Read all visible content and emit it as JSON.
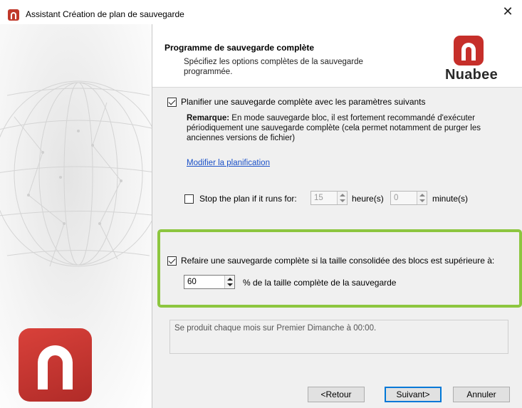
{
  "window": {
    "title": "Assistant Création de plan de sauvegarde",
    "close_symbol": "✕"
  },
  "brand": {
    "name": "Nuabee",
    "accent": "#c62f2a"
  },
  "header": {
    "title": "Programme de sauvegarde complète",
    "description": "Spécifiez les options complètes de la sauvegarde programmée."
  },
  "schedule": {
    "checkbox_label": "Planifier une sauvegarde complète avec les paramètres suivants",
    "checked": true,
    "note_label": "Remarque:",
    "note_text": " En mode sauvegarde bloc, il est fortement recommandé d'exécuter périodiquement une sauvegarde complète (cela permet notamment de purger les anciennes versions de fichier)",
    "modify_link": "Modifier la planification"
  },
  "stop_plan": {
    "checkbox_label": "Stop the plan if it runs for:",
    "checked": false,
    "hours_value": "15",
    "hours_unit": "heure(s)",
    "minutes_value": "0",
    "minutes_unit": "minute(s)"
  },
  "redo_full": {
    "checkbox_label": "Refaire une sauvegarde complète si la taille consolidée des blocs est supérieure à:",
    "checked": true,
    "percent_value": "60",
    "percent_label": "% de la taille complète de la sauvegarde",
    "highlight_color": "#8dc63f"
  },
  "summary": {
    "text": "Se produit chaque mois sur Premier Dimanche à 00:00."
  },
  "buttons": {
    "back": "<Retour",
    "next": "Suivant>",
    "cancel": "Annuler"
  }
}
